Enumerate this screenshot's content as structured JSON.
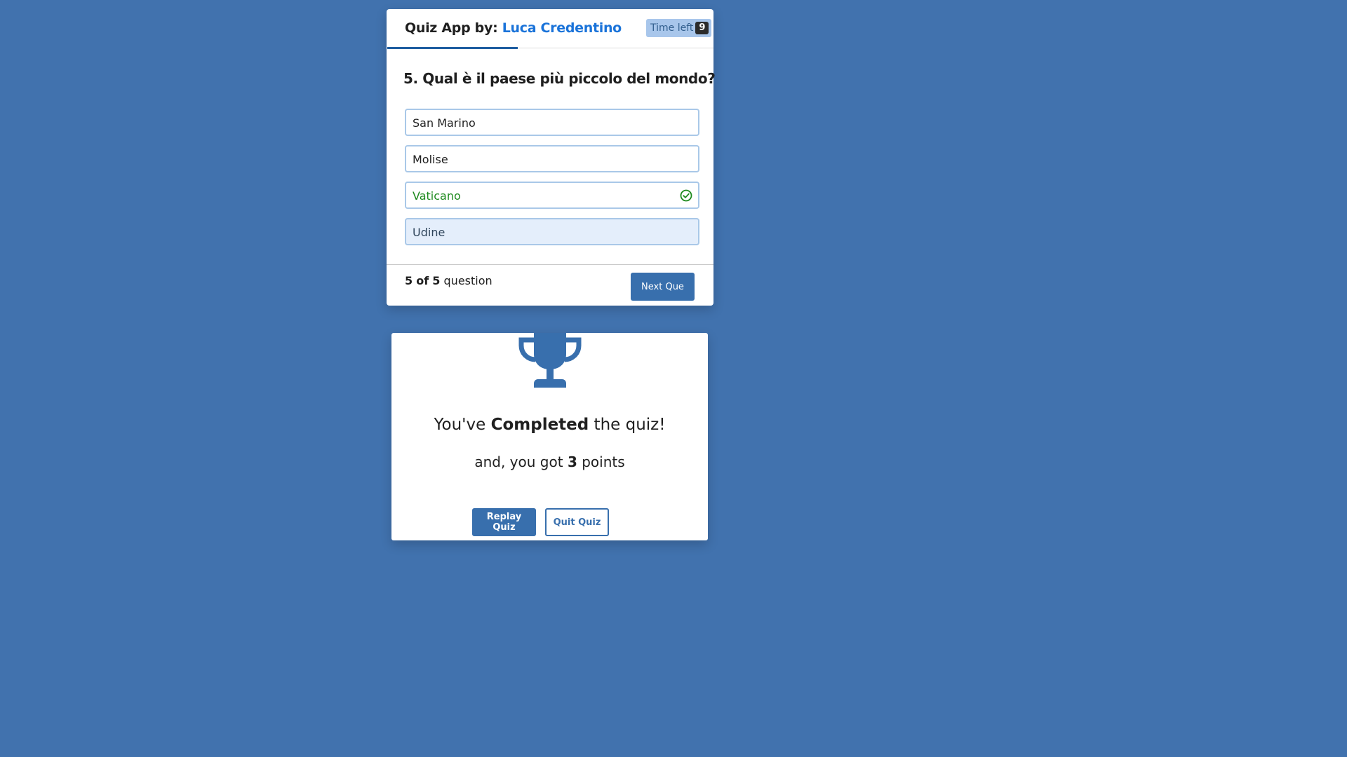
{
  "header": {
    "title_prefix": "Quiz App by:",
    "author": "Luca Credentino",
    "timer_label": "Time left",
    "timer_seconds": "9"
  },
  "question": {
    "number": "5.",
    "text": "Qual è il paese più piccolo del mondo?",
    "options": [
      {
        "label": "San Marino",
        "state": "default"
      },
      {
        "label": "Molise",
        "state": "default"
      },
      {
        "label": "Vaticano",
        "state": "correct",
        "icon": "check-circle-icon"
      },
      {
        "label": "Udine",
        "state": "selected"
      }
    ]
  },
  "footer": {
    "current": "5",
    "of_text": "of",
    "total": "5",
    "suffix": "question",
    "next_label": "Next Que"
  },
  "result": {
    "icon": "trophy-icon",
    "line1_prefix": "You've",
    "line1_bold": "Completed",
    "line1_suffix": "the quiz!",
    "line2_prefix": "and, you got",
    "score": "3",
    "line2_suffix": "points",
    "replay_label": "Replay Quiz",
    "quit_label": "Quit Quiz"
  },
  "colors": {
    "background": "#4172ae",
    "accent": "#386fad",
    "author": "#1a73d9",
    "correct": "#1e8a1e"
  }
}
